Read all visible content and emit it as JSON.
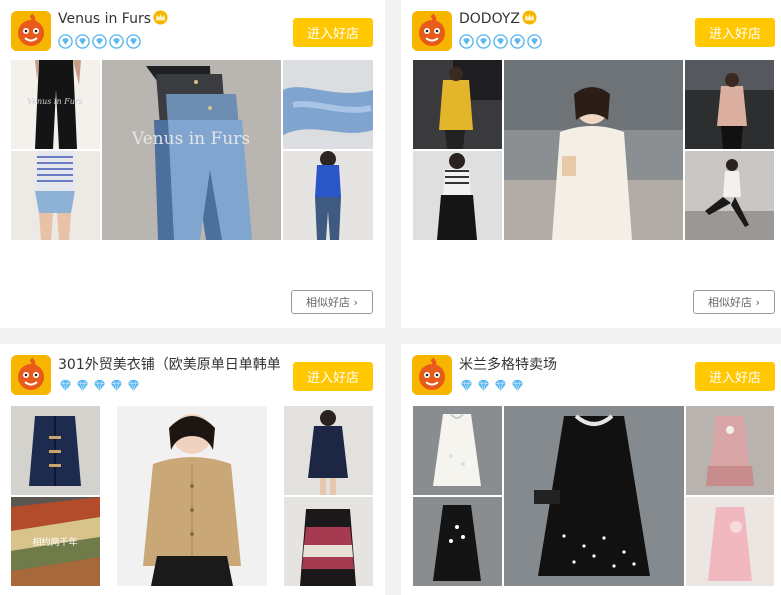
{
  "shops": [
    {
      "name": "Venus in Furs",
      "rank_icon": "crown",
      "rank_badges": [
        "diamond-blue-outline",
        "diamond-blue-outline",
        "diamond-blue-outline",
        "diamond-blue-outline",
        "diamond-blue-outline"
      ],
      "enter_label": "进入好店",
      "similar_label": "相似好店 ›",
      "photo_watermark": "Venus in Furs"
    },
    {
      "name": "DODOYZ",
      "rank_icon": "crown",
      "rank_badges": [
        "diamond-blue-outline",
        "diamond-blue-outline",
        "diamond-blue-outline",
        "diamond-blue-outline",
        "diamond-blue-outline"
      ],
      "enter_label": "进入好店",
      "similar_label": "相似好店 ›"
    },
    {
      "name": "301外贸美衣铺（欧美原单日单韩单",
      "rank_badges": [
        "diamond-blue",
        "diamond-blue",
        "diamond-blue",
        "diamond-blue",
        "diamond-blue"
      ],
      "enter_label": "进入好店"
    },
    {
      "name": "米兰多格特卖场",
      "rank_badges": [
        "diamond-blue",
        "diamond-blue",
        "diamond-blue",
        "diamond-blue"
      ],
      "enter_label": "进入好店"
    }
  ],
  "colors": {
    "accent_button": "#ffc800",
    "diamond": "#5db8f0",
    "crown": "#f7b500"
  }
}
